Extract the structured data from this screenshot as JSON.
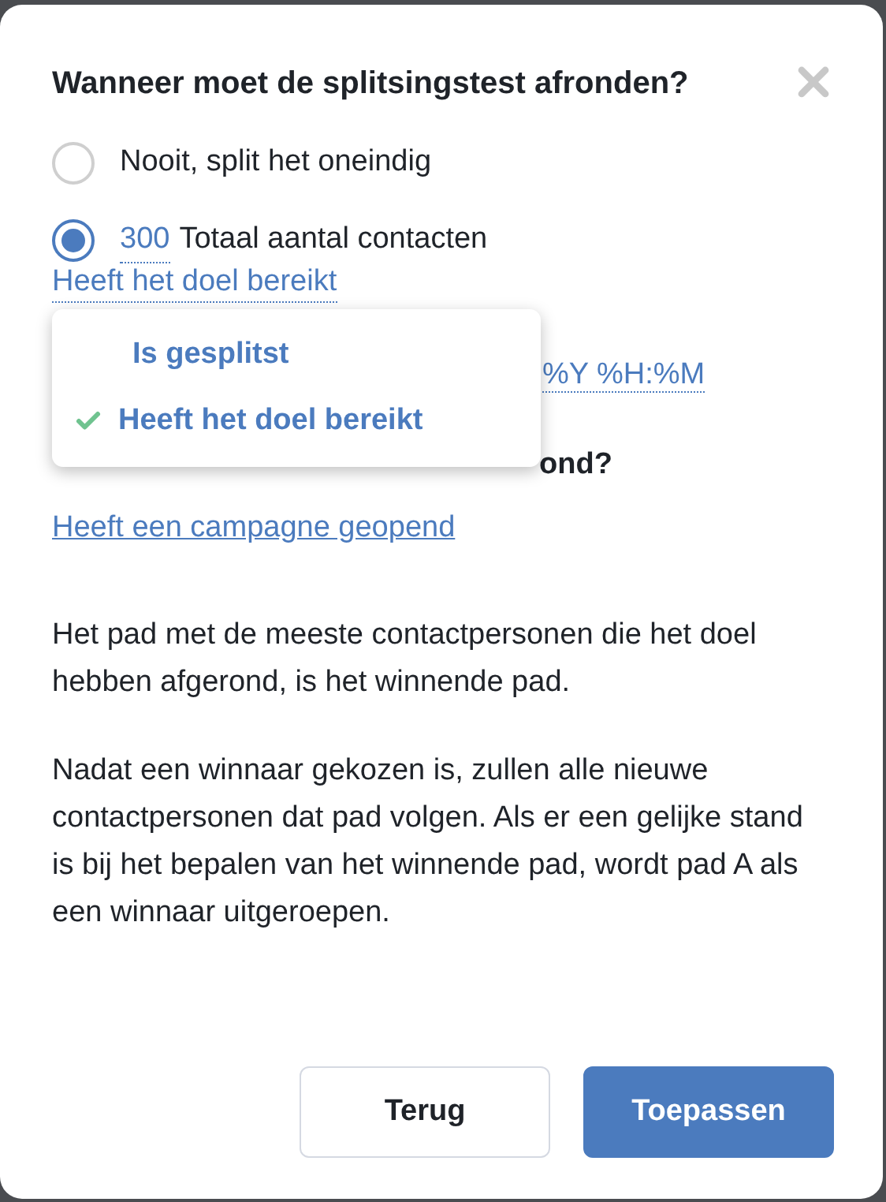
{
  "dialog": {
    "title": "Wanneer moet de splitsingstest afronden?",
    "options": [
      {
        "label": "Nooit, split het oneindig",
        "selected": false
      },
      {
        "count": "300",
        "label": "Totaal aantal contacten",
        "selected": true
      }
    ],
    "criterion_link": "Heeft het doel bereikt",
    "dropdown": {
      "items": [
        {
          "label": "Is gesplitst",
          "selected": false
        },
        {
          "label": "Heeft het doel bereikt",
          "selected": true
        }
      ]
    },
    "date_format_fragment": "%Y %H:%M",
    "question_fragment": "ond?",
    "goal_link": "Heeft een campagne geopend",
    "paragraphs": [
      "Het pad met de meeste contactpersonen die het doel hebben afgerond, is het winnende pad.",
      "Nadat een winnaar gekozen is, zullen alle nieuwe contactpersonen dat pad volgen. Als er een gelijke stand is bij het bepalen van het winnende pad, wordt pad A als een winnaar uitgeroepen."
    ],
    "buttons": [
      {
        "label": "Terug",
        "kind": "secondary"
      },
      {
        "label": "Toepassen",
        "kind": "primary"
      }
    ]
  }
}
